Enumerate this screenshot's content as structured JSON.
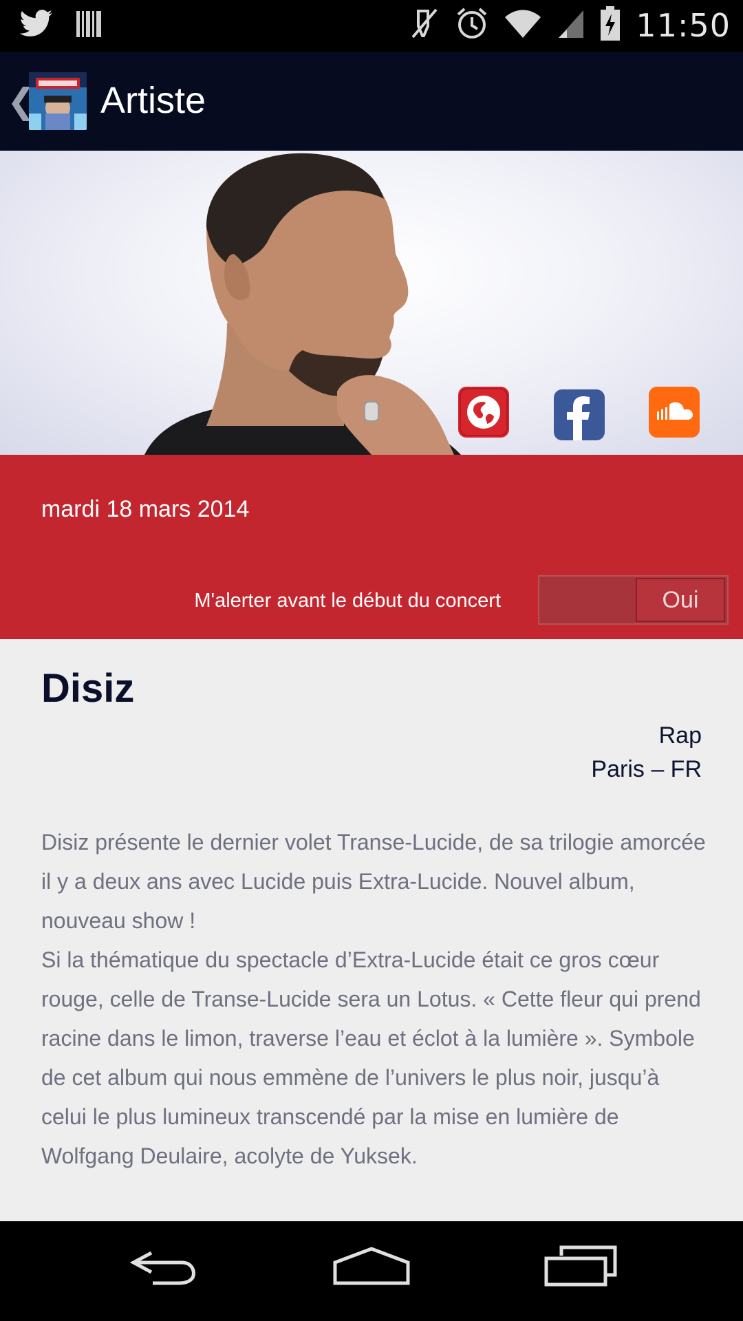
{
  "status_bar": {
    "time": "11:50",
    "icons": [
      "twitter-icon",
      "barcode-icon",
      "mute-icon",
      "alarm-icon",
      "wifi-icon",
      "signal-icon",
      "battery-charging-icon"
    ]
  },
  "action_bar": {
    "back_glyph": "❮",
    "title": "Artiste",
    "logo_icon": "app-logo-icon"
  },
  "hero": {
    "social": [
      "website-icon",
      "facebook-icon",
      "soundcloud-icon"
    ],
    "colors": {
      "website": "#d7252d",
      "facebook": "#3b5998",
      "soundcloud": "#ff6a10"
    }
  },
  "event": {
    "date": "mardi 18 mars 2014",
    "alert_label": "M'alerter avant le début du concert",
    "alert_toggle": "Oui"
  },
  "artist": {
    "name": "Disiz",
    "genre": "Rap",
    "location": "Paris – FR",
    "description": [
      "Disiz présente le dernier volet Transe-Lucide, de sa trilogie amorcée il y a deux ans avec Lucide puis Extra-Lucide. Nouvel album, nouveau show !",
      "Si la thématique du spectacle d’Extra-Lucide était ce gros cœur rouge, celle de Transe-Lucide sera un Lotus. « Cette fleur qui prend racine dans le limon, traverse l’eau et éclot à la lumière ». Symbole de cet album qui nous emmène de l’univers le plus noir, jusqu’à celui le plus lumineux transcendé par la mise en lumière de Wolfgang Deulaire, acolyte de Yuksek."
    ]
  },
  "nav_bar": {
    "buttons": [
      "back-icon",
      "home-icon",
      "recents-icon"
    ]
  },
  "theme": {
    "action_bar_bg": "#060b20",
    "accent_red": "#c4262f",
    "content_bg": "#eeeeee"
  }
}
